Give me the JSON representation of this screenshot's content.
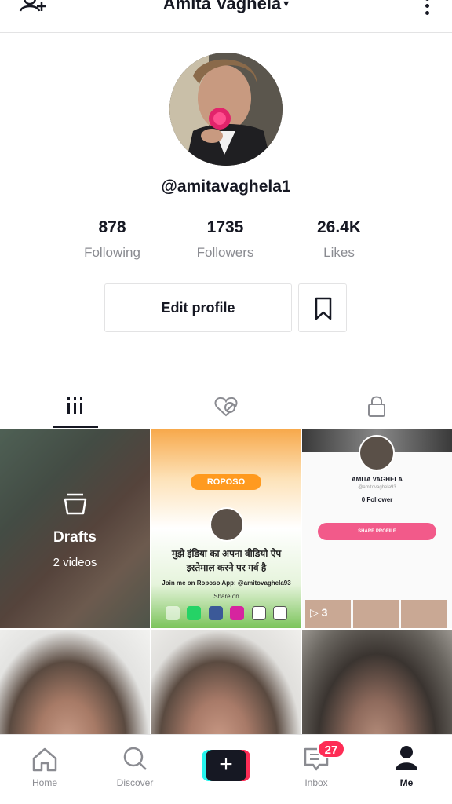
{
  "header": {
    "title": "Amita Vaghela",
    "caret": "▾"
  },
  "profile": {
    "handle": "@amitavaghela1",
    "stats": [
      {
        "value": "878",
        "label": "Following"
      },
      {
        "value": "1735",
        "label": "Followers"
      },
      {
        "value": "26.4K",
        "label": "Likes"
      }
    ],
    "edit_label": "Edit profile"
  },
  "grid": {
    "drafts_label": "Drafts",
    "drafts_count": "2 videos",
    "roposo": {
      "logo": "ROPOSO",
      "hindi_line1": "मुझे इंडिया का अपना वीडियो ऐप",
      "hindi_line2": "इस्तेमाल करने पर गर्व है",
      "join": "Join me on Roposo App: @amitovaghela93",
      "share_on": "Share on"
    },
    "card": {
      "name": "AMITA VAGHELA",
      "user": "@amitovaghela93",
      "followers": "0 Follower",
      "share_btn": "SHARE PROFILE",
      "play_count": "3"
    }
  },
  "bottom_nav": {
    "home": "Home",
    "discover": "Discover",
    "inbox": "Inbox",
    "me": "Me",
    "inbox_badge": "27",
    "plus": "+"
  },
  "colors": {
    "accent": "#fe2c55",
    "cyan": "#25f4ee",
    "text": "#161823",
    "muted": "#8a8b91"
  }
}
